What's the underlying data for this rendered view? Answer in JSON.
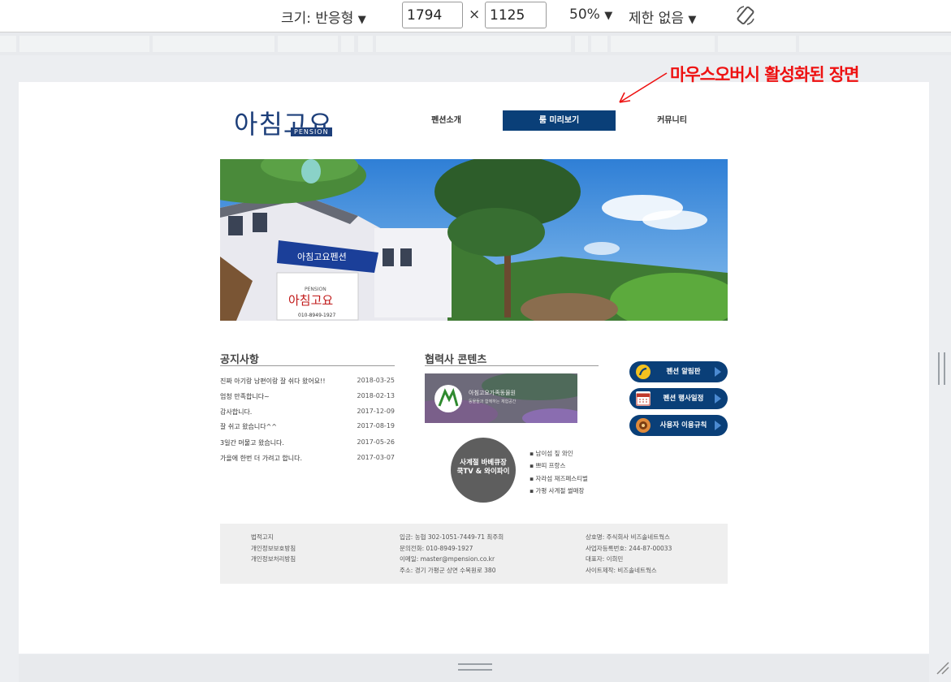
{
  "devtools": {
    "size_label": "크기: 반응형",
    "width": "1794",
    "times": "×",
    "height": "1125",
    "zoom": "50%",
    "throttle": "제한 없음"
  },
  "annotation": "마우스오버시 활성화된 장면",
  "site": {
    "logo": "아침고요",
    "logo_sub": "PENSION",
    "nav": [
      "펜션소개",
      "룸 미리보기",
      "커뮤니티"
    ],
    "hero_sign": {
      "awning": "아침고요펜션",
      "small": "PENSION",
      "big": "아침고요",
      "phone": "010-8949-1927"
    },
    "notice": {
      "title": "공지사항",
      "rows": [
        {
          "text": "진짜 아기랑 남편이랑 잘 쉬다 왔어요!!",
          "date": "2018-03-25"
        },
        {
          "text": "엄청 만족합니다~",
          "date": "2018-02-13"
        },
        {
          "text": "감사합니다.",
          "date": "2017-12-09"
        },
        {
          "text": "잘 쉬고 왔습니다^^",
          "date": "2017-08-19"
        },
        {
          "text": "3일간 머물고 왔습니다.",
          "date": "2017-05-26"
        },
        {
          "text": "가을에 한번 더 가려고 합니다.",
          "date": "2017-03-07"
        }
      ]
    },
    "partner": {
      "title": "협력사 콘텐츠",
      "img_line1": "아침고요가족동물원",
      "img_line2": "동물들과 함께하는 체험공간",
      "circle_line1": "사계절 바베큐장",
      "circle_line2": "쿡TV & 와이파이",
      "bullets": [
        "남이섬 짚 와인",
        "쁘띠 프랑스",
        "자라섬 재즈페스티벌",
        "가평 사계절 썰매장"
      ]
    },
    "quick": [
      {
        "label": "펜션 알림판",
        "icon": "noticeboard-icon"
      },
      {
        "label": "펜션 행사일정",
        "icon": "calendar-icon"
      },
      {
        "label": "사용자 이용규칙",
        "icon": "rules-icon"
      }
    ],
    "footer": {
      "col1": [
        "법적고지",
        "개인정보보호방침",
        "개인정보처리방침"
      ],
      "col2": [
        "입금: 농협 302-1051-7449-71 최주희",
        "문의전화: 010-8949-1927",
        "이메일: master@mpension.co.kr",
        "주소: 경기 가평군 상면 수목원로 380"
      ],
      "col3": [
        "상호명: 주식회사 비즈솔네트웍스",
        "사업자등록번호: 244-87-00033",
        "대표자: 이희민",
        "사이트제작: 비즈솔네트웍스"
      ]
    }
  },
  "colors": {
    "nav_active": "#0a3f78",
    "annotation": "#ee1111",
    "footer_bg": "#efefef"
  }
}
